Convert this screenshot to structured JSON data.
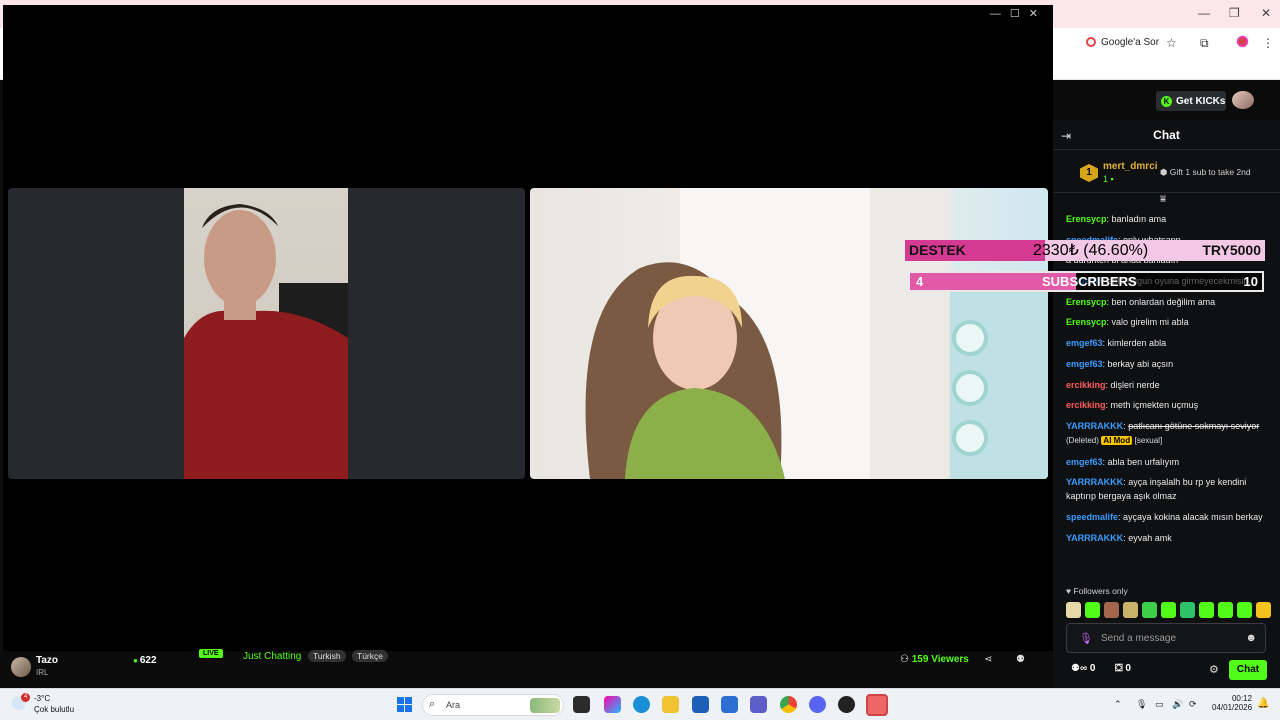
{
  "browser": {
    "google_chip": "Google'a Sor"
  },
  "kick_header": {
    "get_kicks": "Get KICKs"
  },
  "chat": {
    "title": "Chat",
    "pinned": {
      "rank": "1",
      "username": "mert_dmrci",
      "count": "1",
      "gift_text": "Gift 1 sub to take 2nd"
    },
    "messages": [
      {
        "user": "Erensycp",
        "color": "#53fc18",
        "text": "banladın ama"
      },
      {
        "user": "speedmalife",
        "color": "#3b9cff",
        "text": "only whatsapp"
      },
      {
        "user": "",
        "color": "#3b9cff",
        "text": "a dururken bi anda banladın"
      },
      {
        "user": "emgef63",
        "color": "#3b9cff",
        "text": "abla bugun oyuna girmeyecekmisin"
      },
      {
        "user": "Erensycp",
        "color": "#53fc18",
        "text": "ben onlardan değilim ama"
      },
      {
        "user": "Erensycp",
        "color": "#53fc18",
        "text": "valo girelim mi abla"
      },
      {
        "user": "emgef63",
        "color": "#3b9cff",
        "text": "kimlerden abla"
      },
      {
        "user": "emgef63",
        "color": "#3b9cff",
        "text": "berkay abi açsın"
      },
      {
        "user": "ercikking",
        "color": "#ff5c5c",
        "text": "dişleri nerde"
      },
      {
        "user": "ercikking",
        "color": "#ff5c5c",
        "text": "meth içmekten uçmuş"
      }
    ],
    "deleted_message": {
      "user": "YARRRAKKK",
      "color": "#3b9cff",
      "text": "patlıcanı götüne sokmayı seviyor",
      "deleted_label": "(Deleted)",
      "mod_label": "AI Mod",
      "reason": "[sexual]"
    },
    "messages_after": [
      {
        "user": "emgef63",
        "color": "#3b9cff",
        "text": "abla ben urfalıyım"
      },
      {
        "user": "YARRRAKKK",
        "color": "#3b9cff",
        "text": "ayça inşalalh bu rp ye kendini kaptırıp bergaya aşık olmaz"
      },
      {
        "user": "speedmalife",
        "color": "#3b9cff",
        "text": "ayçaya kokina alacak mısın berkay"
      },
      {
        "user": "YARRRAKKK",
        "color": "#3b9cff",
        "text": "eyvah amk"
      }
    ],
    "followers_only": "Followers only",
    "send_placeholder": "Send a message",
    "points": "0",
    "store_count": "0",
    "chat_button": "Chat"
  },
  "overlay": {
    "destek_label": "DESTEK",
    "destek_amount": "2330₺ (46.60%)",
    "destek_goal": "TRY5000",
    "subs_count": "4",
    "subs_label": "SUBSCRIBERS",
    "subs_goal": "10"
  },
  "stream_info": {
    "streamer": "Tazo",
    "streamer_sub": "IRL",
    "viewers_left": "622",
    "live": "LIVE",
    "category": "Just Chatting",
    "tags": [
      "Turkish",
      "Türkçe"
    ],
    "viewers": "159",
    "viewers_label": "Viewers"
  },
  "taskbar": {
    "notif_count": "4",
    "temperature": "-3°C",
    "weather": "Çok bulutlu",
    "search_text": "Ara",
    "time": "00:12",
    "date": "04/01/2026"
  },
  "colors": {
    "kick_green": "#53fc18",
    "overlay_pink": "#d53a93"
  }
}
